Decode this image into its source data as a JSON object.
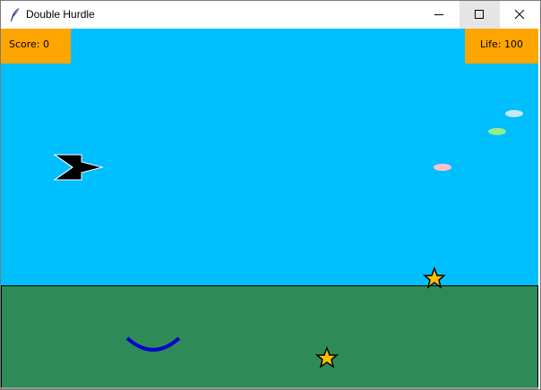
{
  "window": {
    "title": "Double Hurdle",
    "controls": {
      "minimize": "minimize-icon",
      "maximize": "maximize-icon",
      "close": "close-icon"
    }
  },
  "hud": {
    "score_label": "Score: 0",
    "life_label": "Life: 100"
  },
  "colors": {
    "sky": "#00bfff",
    "ground": "#2e8b57",
    "hud": "#ffa500",
    "player": "#000000",
    "catcher": "#0000cd",
    "star": "#ffc000",
    "cloud_light_blue": "#c6e8f5",
    "cloud_green": "#90ee90",
    "cloud_pink": "#ffc0cb"
  },
  "icons": {
    "app": "feather-icon",
    "player": "arrow-ship-icon",
    "hurdle": "star-icon",
    "catcher": "arc-catcher-icon"
  }
}
